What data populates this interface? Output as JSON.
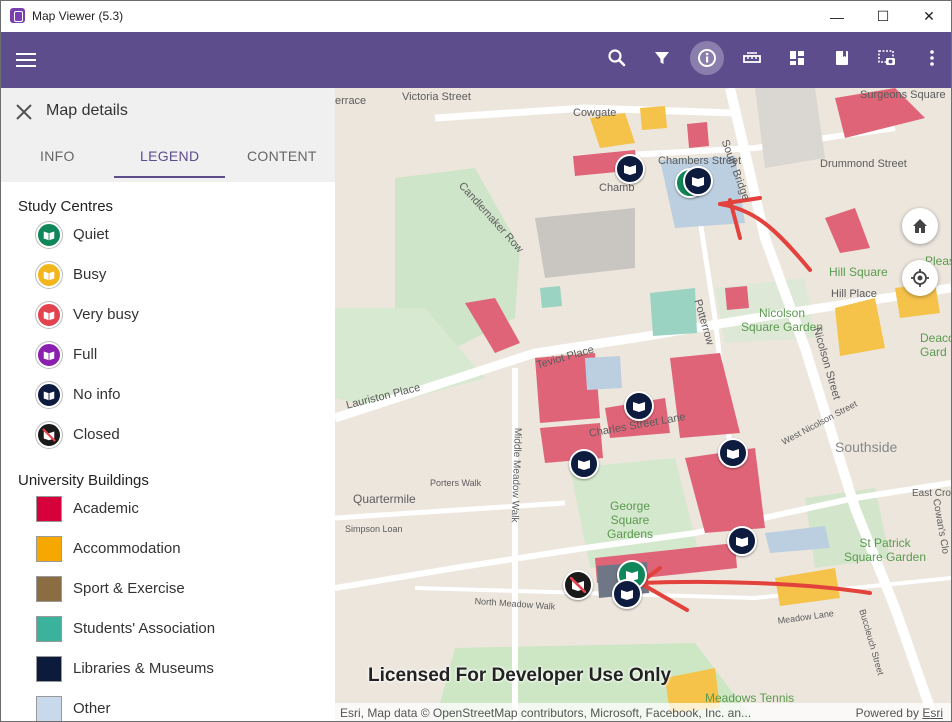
{
  "window": {
    "title": "Map Viewer (5.3)",
    "minimize": "—",
    "maximize": "☐",
    "close": "✕"
  },
  "appbar": {
    "color": "#5e4d8c",
    "menu_icon": "hamburger-icon",
    "tools": [
      {
        "icon": "search-icon"
      },
      {
        "icon": "filter-icon"
      },
      {
        "icon": "info-icon",
        "active": true
      },
      {
        "icon": "measure-icon"
      },
      {
        "icon": "basemap-gallery-icon"
      },
      {
        "icon": "bookmark-icon"
      },
      {
        "icon": "screenshot-icon"
      },
      {
        "icon": "more-vert-icon"
      }
    ]
  },
  "panel": {
    "title": "Map details",
    "tabs": [
      {
        "label": "INFO",
        "active": false
      },
      {
        "label": "LEGEND",
        "active": true
      },
      {
        "label": "CONTENT",
        "active": false
      }
    ]
  },
  "legend": {
    "study_centres": {
      "title": "Study Centres",
      "items": [
        {
          "label": "Quiet",
          "color": "#10875a"
        },
        {
          "label": "Busy",
          "color": "#f2b51c"
        },
        {
          "label": "Very busy",
          "color": "#e2434f"
        },
        {
          "label": "Full",
          "color": "#8a1fb0"
        },
        {
          "label": "No info",
          "color": "#0d1b3e"
        },
        {
          "label": "Closed",
          "color": "#1a1a1a"
        }
      ]
    },
    "buildings": {
      "title": "University Buildings",
      "items": [
        {
          "label": "Academic",
          "color": "#d6003a"
        },
        {
          "label": "Accommodation",
          "color": "#f6a800"
        },
        {
          "label": "Sport & Exercise",
          "color": "#8b6d44"
        },
        {
          "label": "Students' Association",
          "color": "#3bb39c"
        },
        {
          "label": "Libraries & Museums",
          "color": "#0c1a3c"
        },
        {
          "label": "Other",
          "color": "#c7d9ea"
        }
      ]
    }
  },
  "map": {
    "labels": {
      "terrace": "errace",
      "victoria_street": "Victoria Street",
      "cowgate": "Cowgate",
      "south_bridge": "South Bridge",
      "chambers_street": "Chambers Street",
      "chambers": "Chamb",
      "candlemaker_row": "Candlemaker Row",
      "drummond_street": "Drummond Street",
      "surgeons_square": "Surgeons Square",
      "hill_square": "Hill Square",
      "hill_place": "Hill Place",
      "pleas": "Pleas",
      "nicolson_square_garden": "Nicolson Square Garden",
      "nicolson_street": "Nicolson Street",
      "deacon": "Deaco Gard",
      "potterrow": "Potterrow",
      "teviot_place": "Teviot Place",
      "lauriston_place": "Lauriston Place",
      "charles_street_lane": "Charles Street Lane",
      "west_nicolson_street": "West Nicolson Street",
      "southside": "Southside",
      "east_cross": "East Cros",
      "cowans_close": "Cowan's Clo",
      "porters_walk": "Porters Walk",
      "middle_meadow_walk": "Middle Meadow Walk",
      "quartermile": "Quartermile",
      "george_square_gardens": "George Square Gardens",
      "simpson_loan": "Simpson Loan",
      "st_patrick_square_garden": "St Patrick Square Garden",
      "north_meadow_walk": "North Meadow Walk",
      "meadow_lane": "Meadow Lane",
      "buccleuch_street": "Buccleuch Street",
      "meadows_tennis": "Meadows Tennis"
    },
    "home_button_icon": "home-icon",
    "locate_button_icon": "locate-icon",
    "watermark": "Licensed For Developer Use Only",
    "attribution": "Esri, Map data © OpenStreetMap contributors, Microsoft, Facebook, Inc. an...",
    "powered_by": "Powered by",
    "esri_link": "Esri"
  }
}
